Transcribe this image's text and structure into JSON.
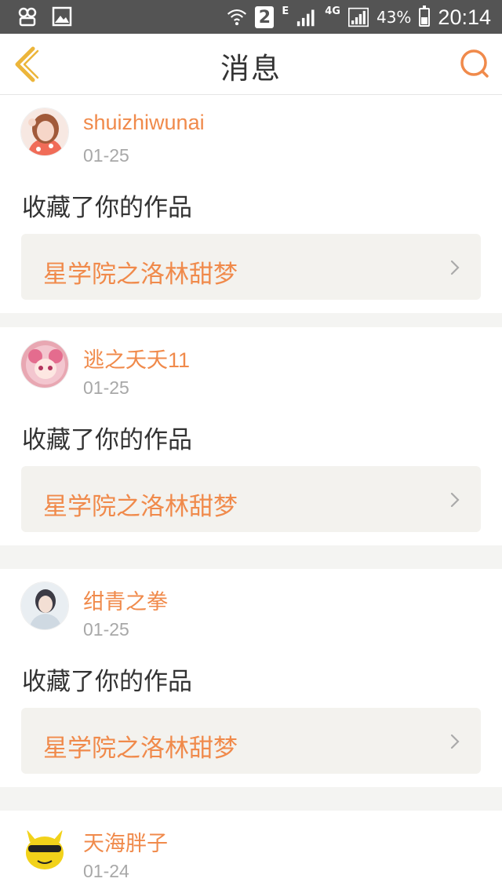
{
  "status_bar": {
    "sim": "2",
    "network_type": "E",
    "network_4g": "4G",
    "battery": "43%",
    "time": "20:14"
  },
  "navbar": {
    "title": "消息",
    "back_icon": "chevron-left-icon",
    "search_icon": "search-icon"
  },
  "colors": {
    "accent": "#f08a4b",
    "status_bar": "#545454",
    "work_bg": "#f3f2ee",
    "divider_bg": "#f4f4f2"
  },
  "messages": [
    {
      "username": "shuizhiwunai",
      "date": "01-25",
      "action": "收藏了你的作品",
      "work": "星学院之洛林甜梦"
    },
    {
      "username": "逃之夭夭11",
      "date": "01-25",
      "action": "收藏了你的作品",
      "work": "星学院之洛林甜梦"
    },
    {
      "username": "绀青之拳",
      "date": "01-25",
      "action": "收藏了你的作品",
      "work": "星学院之洛林甜梦"
    },
    {
      "username": "天海胖子",
      "date": "01-24"
    }
  ]
}
